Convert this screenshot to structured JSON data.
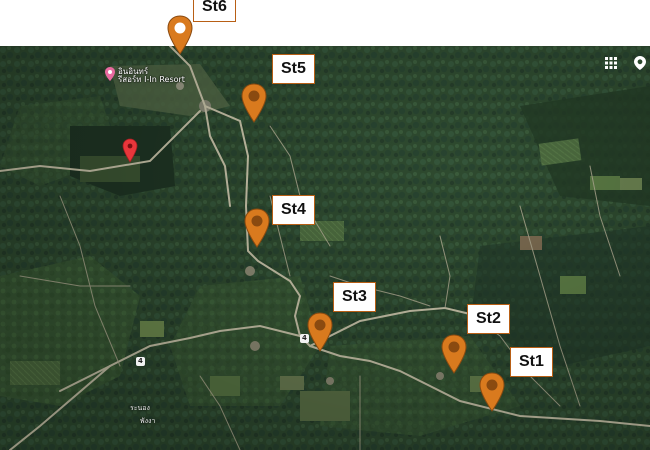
{
  "map": {
    "view": "satellite",
    "stations": [
      {
        "id": "st1",
        "label": "St1"
      },
      {
        "id": "st2",
        "label": "St2"
      },
      {
        "id": "st3",
        "label": "St3"
      },
      {
        "id": "st4",
        "label": "St4"
      },
      {
        "id": "st5",
        "label": "St5"
      },
      {
        "id": "st6",
        "label": "St6"
      }
    ],
    "poi": {
      "name_line1": "อินอินทร์",
      "name_line2": "รีสอร์ท I-In Resort"
    },
    "road_labels": [
      "ระนอง",
      "พังงา"
    ],
    "route_shields": [
      "4",
      "4"
    ],
    "colors": {
      "station_pin": "#d97a1e",
      "station_pin_dark": "#8a4a10",
      "label_border": "#b85f15",
      "location_pin": "#e8363b",
      "vegetation": "#2c4a2e",
      "road": "#c7c2a8"
    },
    "icons": [
      "grid-icon",
      "place-icon",
      "location-pin-icon",
      "station-pin-icon",
      "poi-marker-icon"
    ]
  }
}
